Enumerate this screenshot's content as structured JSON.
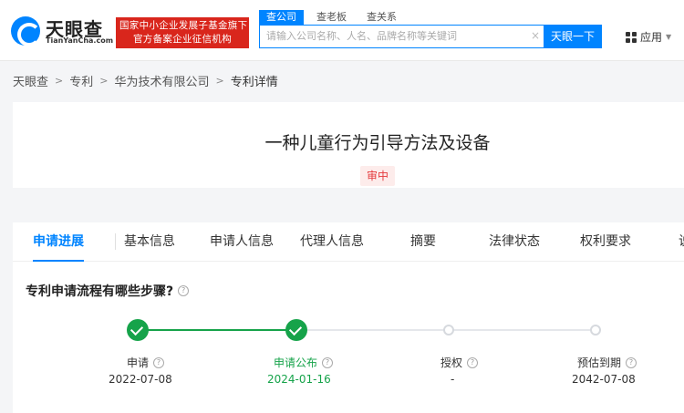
{
  "header": {
    "logo_text": "天眼查",
    "logo_sub": "TianYanCha.com",
    "banner_line1": "国家中小企业发展子基金旗下",
    "banner_line2": "官方备案企业征信机构",
    "search_tabs": [
      {
        "label": "查公司",
        "active": true
      },
      {
        "label": "查老板",
        "active": false
      },
      {
        "label": "查关系",
        "active": false
      }
    ],
    "search_placeholder": "请输入公司名称、人名、品牌名称等关键词",
    "search_button": "天眼一下",
    "apps_label": "应用"
  },
  "breadcrumb": [
    "天眼查",
    "专利",
    "华为技术有限公司",
    "专利详情"
  ],
  "patent": {
    "title": "一种儿童行为引导方法及设备",
    "status": "审中"
  },
  "tabs": [
    "申请进展",
    "基本信息",
    "申请人信息",
    "代理人信息",
    "摘要",
    "法律状态",
    "权利要求",
    "说"
  ],
  "section_title": "专利申请流程有哪些步骤?",
  "steps": [
    {
      "label": "申请",
      "date": "2022-07-08",
      "done": true
    },
    {
      "label": "申请公布",
      "date": "2024-01-16",
      "done": true
    },
    {
      "label": "授权",
      "date": "-",
      "done": false
    },
    {
      "label": "预估到期",
      "date": "2042-07-08",
      "done": false
    }
  ],
  "colors": {
    "brand_blue": "#0084ff",
    "banner_red": "#d9261c",
    "done_green": "#16a34a",
    "status_red": "#e4393c"
  }
}
